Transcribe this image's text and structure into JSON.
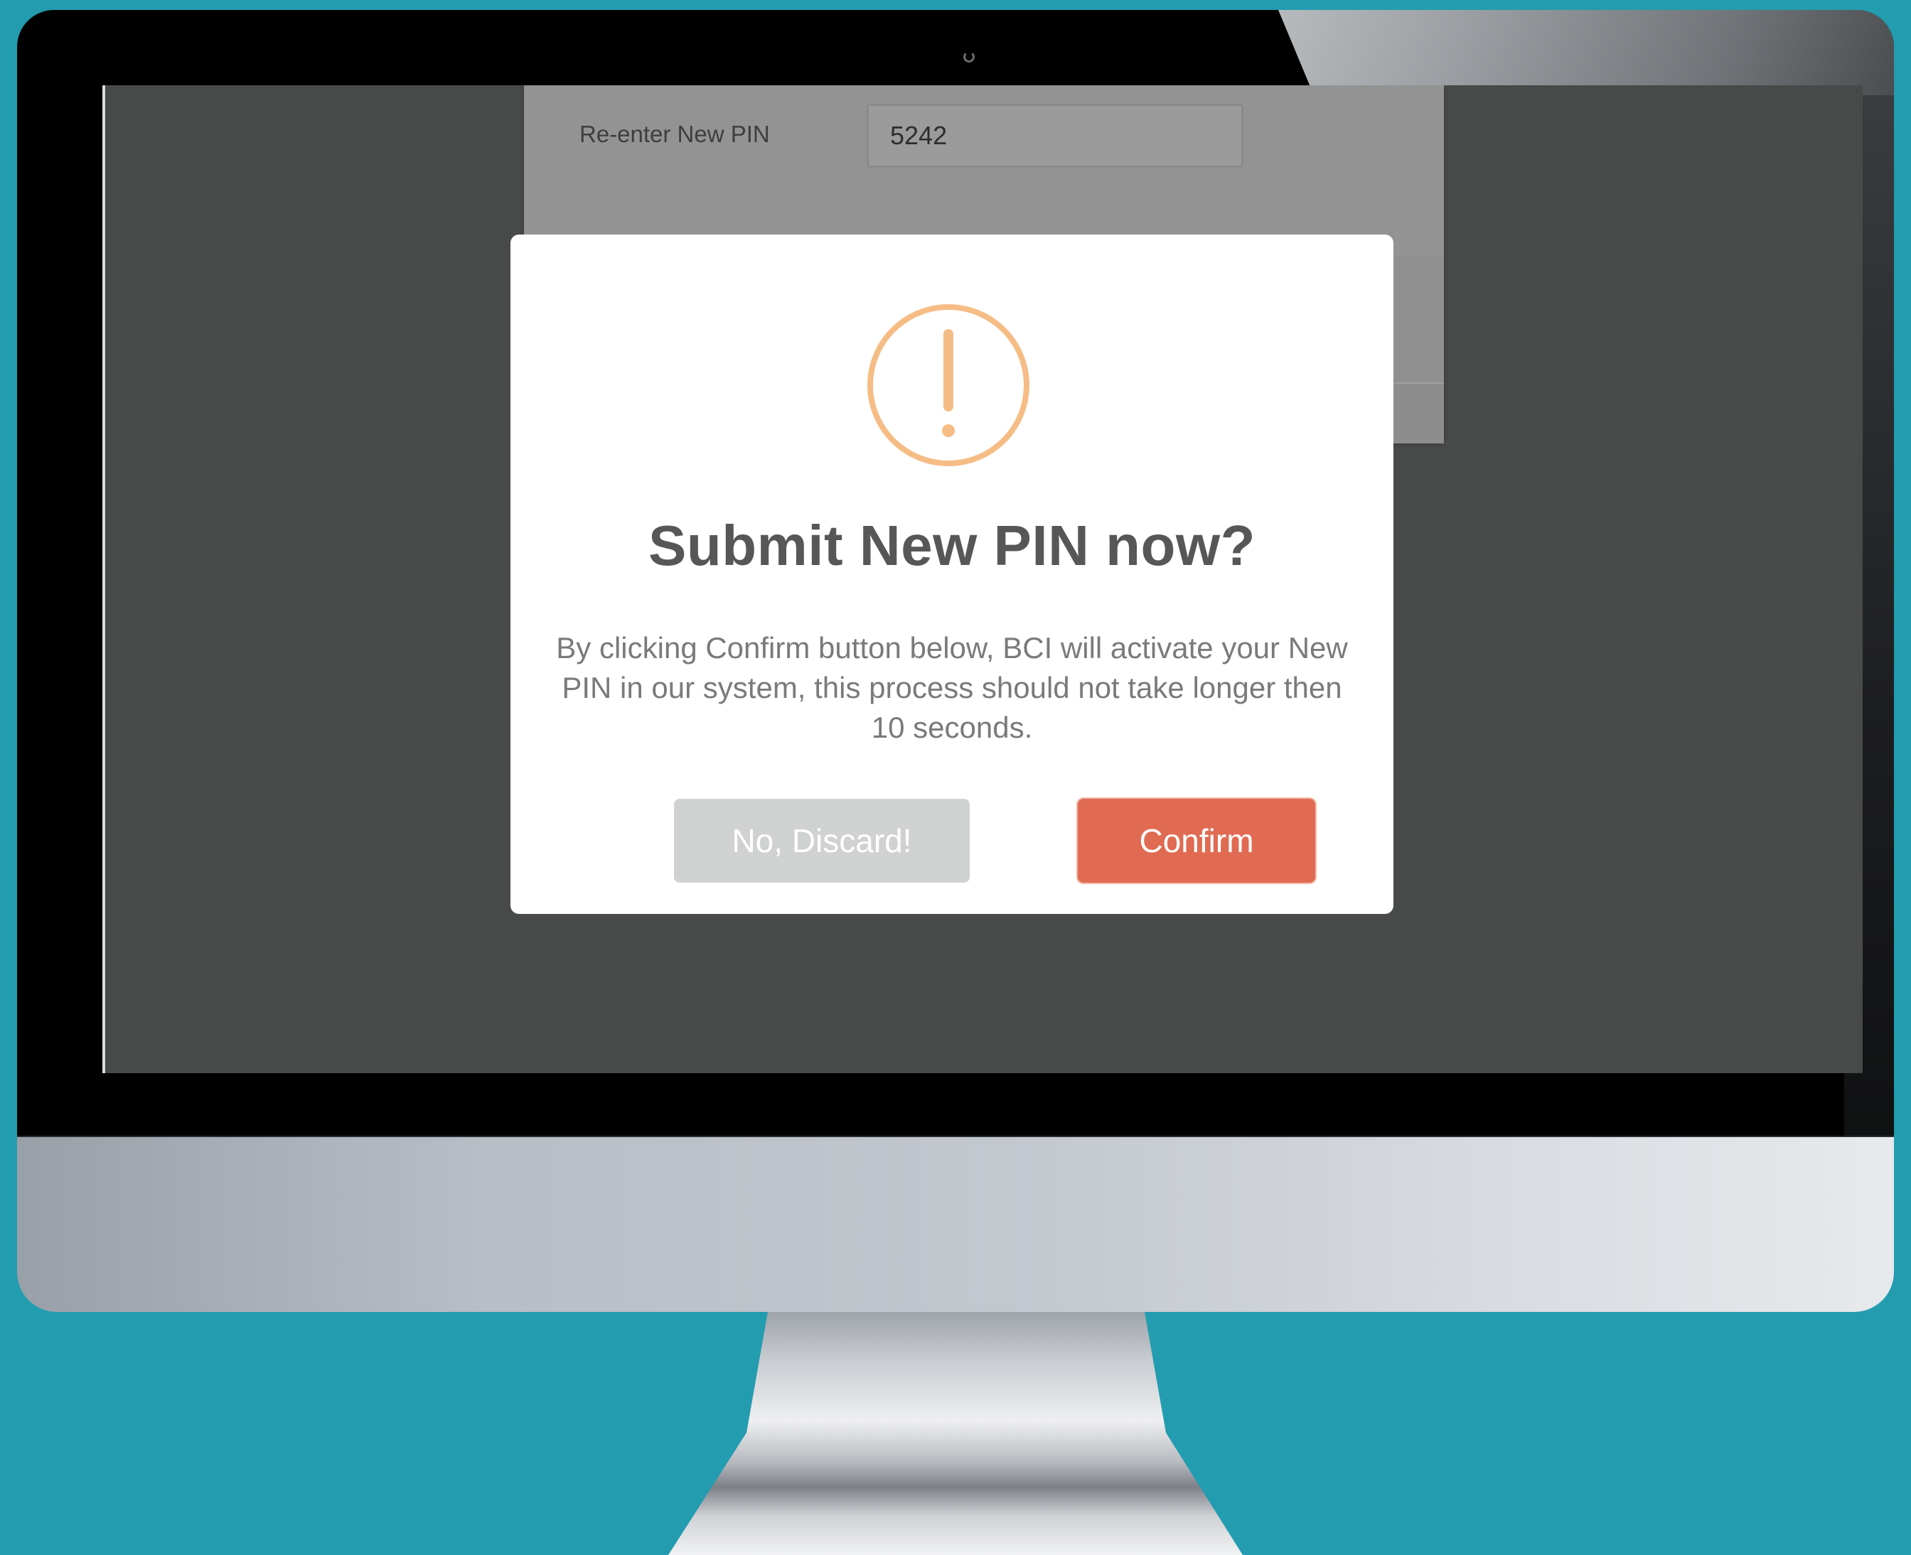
{
  "background_form": {
    "reenter_pin_label": "Re-enter New PIN",
    "reenter_pin_value": "5242"
  },
  "dialog": {
    "icon": "warning-exclamation-icon",
    "title": "Submit New PIN now?",
    "message": "By clicking Confirm button below, BCI will activate your New PIN in our system, this process should not take longer then 10 seconds.",
    "discard_label": "No, Discard!",
    "confirm_label": "Confirm"
  },
  "colors": {
    "page_background": "#239cb0",
    "overlay": "#484949",
    "warning_icon": "#f5bd85",
    "title_text": "#575757",
    "discard_button": "#d0d1d1",
    "confirm_button": "#e06b52"
  }
}
